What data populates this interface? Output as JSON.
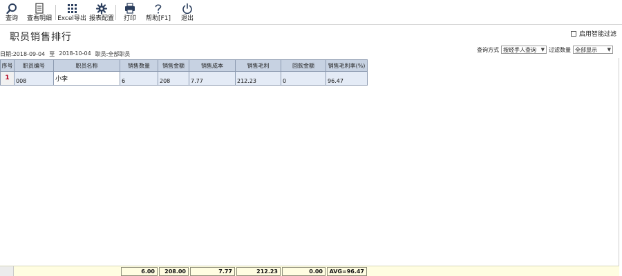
{
  "toolbar": {
    "query": "查询",
    "details": "查看明细",
    "excel": "Excel导出",
    "report_config": "报表配置",
    "print": "打印",
    "help": "帮助[F1]",
    "exit": "退出"
  },
  "page": {
    "title": "职员销售排行",
    "smart_filter_label": "启用智能过滤"
  },
  "meta": {
    "date_label": "日期:2018-09-04",
    "to_label": "至",
    "end_date": "2018-10-04",
    "employee_label": "职员:全部职员"
  },
  "query_options": {
    "mode_label": "查询方式",
    "mode_value": "按经手人查询",
    "filter_label": "过滤数量",
    "filter_value": "全部显示"
  },
  "table": {
    "headers": [
      "序号",
      "职员编号",
      "职员名称",
      "销售数量",
      "销售金额",
      "销售成本",
      "销售毛利",
      "回款金额",
      "销售毛利率(%)"
    ],
    "rows": [
      {
        "seq": "1",
        "code": "008",
        "name": "小李",
        "qty": "6",
        "amount": "208",
        "cost": "7.77",
        "profit": "212.23",
        "refund": "0",
        "margin": "96.47"
      }
    ]
  },
  "totals": {
    "qty": "6.00",
    "amount": "208.00",
    "cost": "7.77",
    "profit": "212.23",
    "refund": "0.00",
    "margin": "AVG=96.47"
  }
}
